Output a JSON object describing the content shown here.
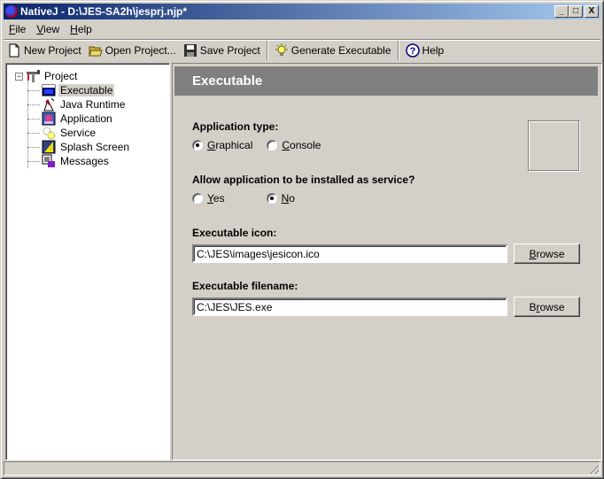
{
  "window": {
    "title": "NativeJ - D:\\JES-SA2h\\jesprj.njp*",
    "controls": {
      "minimize": "_",
      "maximize": "□",
      "close": "X"
    }
  },
  "menubar": [
    {
      "label": "File",
      "accel": "F",
      "rest": "ile"
    },
    {
      "label": "View",
      "accel": "V",
      "rest": "iew"
    },
    {
      "label": "Help",
      "accel": "H",
      "rest": "elp"
    }
  ],
  "toolbar": [
    {
      "label": "New Project",
      "icon": "new-document-icon"
    },
    {
      "label": "Open Project...",
      "icon": "open-folder-icon"
    },
    {
      "label": "Save Project",
      "icon": "floppy-disk-icon"
    },
    {
      "label": "Generate Executable",
      "icon": "lightbulb-icon"
    },
    {
      "label": "Help",
      "icon": "help-icon"
    }
  ],
  "tree": {
    "root": {
      "label": "Project",
      "expander": "−"
    },
    "items": [
      {
        "label": "Executable",
        "icon": "executable-icon",
        "selected": true
      },
      {
        "label": "Java Runtime",
        "icon": "java-runtime-icon",
        "selected": false
      },
      {
        "label": "Application",
        "icon": "application-icon",
        "selected": false
      },
      {
        "label": "Service",
        "icon": "service-gear-icon",
        "selected": false
      },
      {
        "label": "Splash Screen",
        "icon": "splash-screen-icon",
        "selected": false
      },
      {
        "label": "Messages",
        "icon": "messages-icon",
        "selected": false
      }
    ]
  },
  "panel": {
    "title": "Executable",
    "app_type": {
      "label": "Application type:",
      "options": [
        {
          "accel": "G",
          "rest": "raphical",
          "checked": true
        },
        {
          "accel": "C",
          "rest": "onsole",
          "checked": false
        }
      ]
    },
    "service": {
      "label": "Allow application to be installed as service?",
      "options": [
        {
          "accel": "Y",
          "rest": "es",
          "checked": false
        },
        {
          "accel": "N",
          "rest": "o",
          "checked": true
        }
      ]
    },
    "icon_field": {
      "label": "Executable icon:",
      "value": "C:\\JES\\images\\jesicon.ico",
      "button": {
        "accel": "B",
        "rest": "rowse"
      }
    },
    "filename_field": {
      "label": "Executable filename:",
      "value": "C:\\JES\\JES.exe",
      "button": {
        "pre": "B",
        "accel": "r",
        "rest": "owse"
      }
    }
  },
  "statusbar": {
    "text": ""
  }
}
